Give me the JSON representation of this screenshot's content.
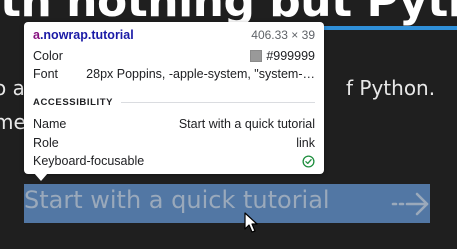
{
  "background": {
    "heading": "th nothing but Pyth",
    "para_line_1_left": "o a",
    "para_line_1_right": "f Python.",
    "para_line_2_left": "me"
  },
  "link": {
    "text": "Start with a quick tutorial",
    "arrow_icon": "long-arrow-right-icon"
  },
  "tooltip": {
    "selector_tag": "a",
    "selector_class": ".nowrap.tutorial",
    "dimensions": "406.33 × 39",
    "color_label": "Color",
    "color_value": "#999999",
    "font_label": "Font",
    "font_value": "28px Poppins, -apple-system, \"system-…",
    "section_title": "ACCESSIBILITY",
    "name_label": "Name",
    "name_value": "Start with a quick tutorial",
    "role_label": "Role",
    "role_value": "link",
    "focus_label": "Keyboard-focusable",
    "focus_icon": "check-circle-icon"
  },
  "colors": {
    "highlight": "#6496d2",
    "swatch": "#999999",
    "check": "#1e8e3e",
    "accent_underline": "#2f8fd8"
  }
}
